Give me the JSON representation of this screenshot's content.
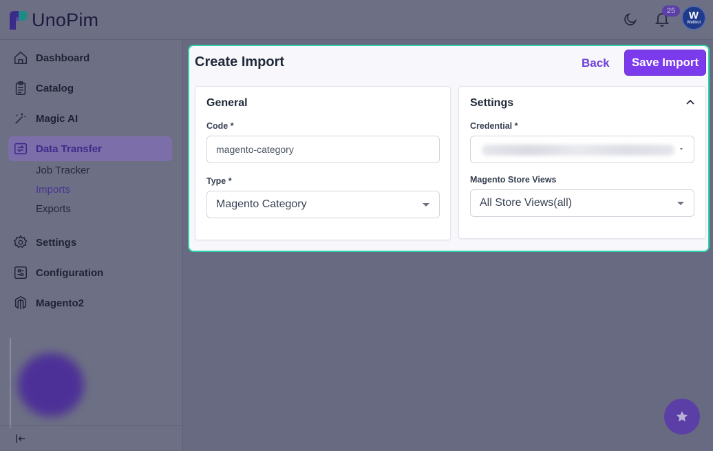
{
  "app": {
    "logo_text": "UnoPim"
  },
  "header": {
    "notification_count": "25",
    "avatar_letter": "W",
    "avatar_subtext": "Webkul"
  },
  "sidebar": {
    "items": [
      {
        "label": "Dashboard",
        "icon": "home-icon"
      },
      {
        "label": "Catalog",
        "icon": "clipboard-icon"
      },
      {
        "label": "Magic AI",
        "icon": "magic-wand-icon"
      },
      {
        "label": "Data Transfer",
        "icon": "data-transfer-icon",
        "active": true
      },
      {
        "label": "Settings",
        "icon": "gear-icon"
      },
      {
        "label": "Configuration",
        "icon": "sliders-icon"
      },
      {
        "label": "Magento2",
        "icon": "magento-icon"
      }
    ],
    "sub_items": [
      {
        "label": "Job Tracker"
      },
      {
        "label": "Imports",
        "active": true
      },
      {
        "label": "Exports"
      }
    ]
  },
  "page": {
    "title": "Create Import",
    "back_label": "Back",
    "save_label": "Save Import"
  },
  "general": {
    "title": "General",
    "code_label": "Code *",
    "code_value": "magento-category",
    "type_label": "Type *",
    "type_value": "Magento Category"
  },
  "settings": {
    "title": "Settings",
    "credential_label": "Credential *",
    "store_views_label": "Magento Store Views",
    "store_views_value": "All Store Views(all)"
  },
  "colors": {
    "accent": "#7c3aed",
    "highlight_border": "#2dd4a8",
    "overlay": "#676a80"
  }
}
